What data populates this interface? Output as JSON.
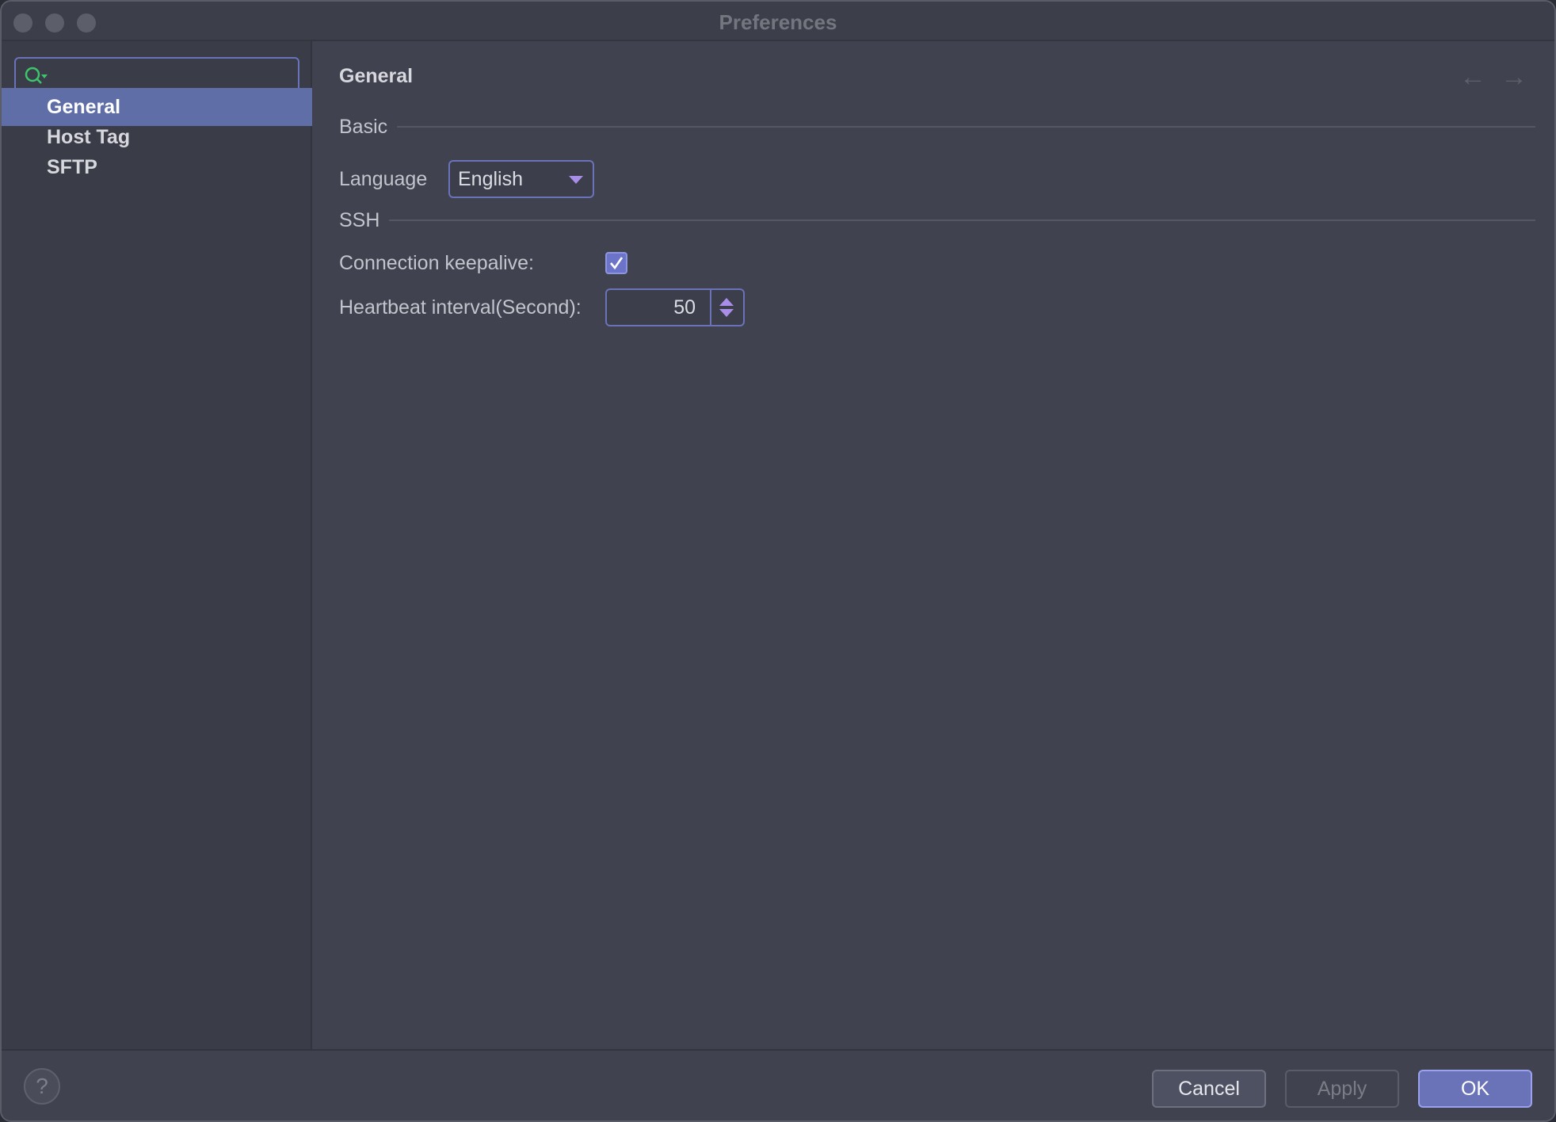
{
  "window": {
    "title": "Preferences"
  },
  "sidebar": {
    "search": {
      "placeholder": "",
      "value": ""
    },
    "items": [
      {
        "label": "General",
        "active": true
      },
      {
        "label": "Host Tag",
        "active": false
      },
      {
        "label": "SFTP",
        "active": false
      }
    ]
  },
  "main": {
    "title": "General",
    "back_icon": "arrow-left-icon",
    "forward_icon": "arrow-right-icon",
    "sections": {
      "basic": "Basic",
      "ssh": "SSH"
    },
    "language": {
      "label": "Language",
      "value": "English"
    },
    "keepalive": {
      "label": "Connection keepalive:",
      "checked": true
    },
    "heartbeat": {
      "label": "Heartbeat interval(Second):",
      "value": "50"
    }
  },
  "footer": {
    "help": "?",
    "cancel": "Cancel",
    "apply": "Apply",
    "ok": "OK"
  },
  "colors": {
    "accent": "#6b73b8",
    "selection": "#5f6ea6",
    "caret": "#a98ee8"
  }
}
